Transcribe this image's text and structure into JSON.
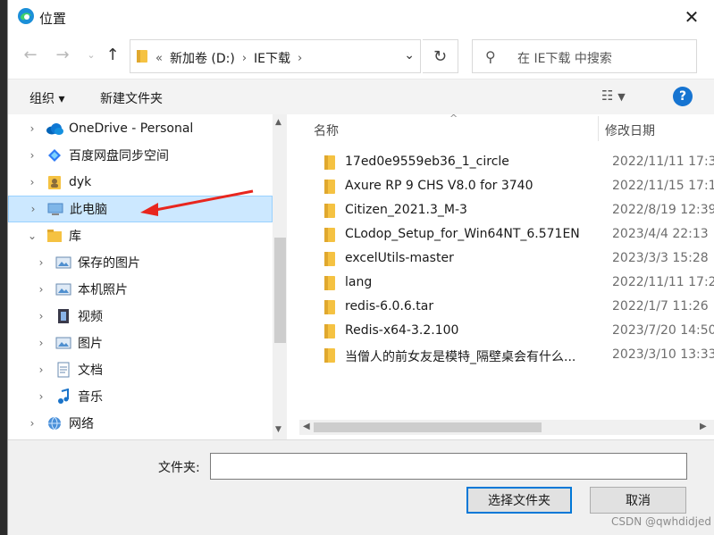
{
  "window": {
    "title": "位置"
  },
  "address": {
    "crumbs": [
      "«",
      "新加卷 (D:)",
      "IE下载"
    ],
    "search_placeholder": "在 IE下载 中搜索"
  },
  "commands": {
    "organize": "组织 ▾",
    "new_folder": "新建文件夹"
  },
  "nav_tree": [
    {
      "label": "OneDrive - Personal",
      "icon": "cloud-icon",
      "expandable": true,
      "indent": 0
    },
    {
      "label": "百度网盘同步空间",
      "icon": "baidu-netdisk-icon",
      "expandable": true,
      "indent": 0
    },
    {
      "label": "dyk",
      "icon": "user-folder-icon",
      "expandable": true,
      "indent": 0
    },
    {
      "label": "此电脑",
      "icon": "computer-icon",
      "expandable": true,
      "indent": 0,
      "selected": true
    },
    {
      "label": "库",
      "icon": "library-icon",
      "expandable": true,
      "expanded": true,
      "indent": 0
    },
    {
      "label": "保存的图片",
      "icon": "pictures-icon",
      "expandable": true,
      "indent": 1
    },
    {
      "label": "本机照片",
      "icon": "pictures-icon",
      "expandable": true,
      "indent": 1
    },
    {
      "label": "视频",
      "icon": "video-icon",
      "expandable": true,
      "indent": 1
    },
    {
      "label": "图片",
      "icon": "pictures-icon",
      "expandable": true,
      "indent": 1
    },
    {
      "label": "文档",
      "icon": "documents-icon",
      "expandable": true,
      "indent": 1
    },
    {
      "label": "音乐",
      "icon": "music-icon",
      "expandable": true,
      "indent": 1
    },
    {
      "label": "网络",
      "icon": "network-icon",
      "expandable": true,
      "indent": 0
    }
  ],
  "columns": {
    "name": "名称",
    "modified": "修改日期"
  },
  "files": [
    {
      "name": "17ed0e9559eb36_1_circle",
      "date": "2022/11/11 17:3"
    },
    {
      "name": "Axure RP 9 CHS V8.0 for 3740",
      "date": "2022/11/15 17:1"
    },
    {
      "name": "Citizen_2021.3_M-3",
      "date": "2022/8/19 12:39"
    },
    {
      "name": "CLodop_Setup_for_Win64NT_6.571EN",
      "date": "2023/4/4 22:13"
    },
    {
      "name": "excelUtils-master",
      "date": "2023/3/3 15:28"
    },
    {
      "name": "lang",
      "date": "2022/11/11 17:2"
    },
    {
      "name": "redis-6.0.6.tar",
      "date": "2022/1/7 11:26"
    },
    {
      "name": "Redis-x64-3.2.100",
      "date": "2023/7/20 14:50"
    },
    {
      "name": "当僧人的前女友是模特_隔壁桌会有什么...",
      "date": "2023/3/10 13:33"
    }
  ],
  "footer": {
    "folder_label": "文件夹:",
    "folder_value": "",
    "select_button": "选择文件夹",
    "cancel_button": "取消"
  },
  "watermark": "CSDN @qwhdidjed",
  "colors": {
    "accent": "#0078d7",
    "selection": "#cce8ff",
    "folder": "#f5c242",
    "annotation": "#e8261e"
  }
}
